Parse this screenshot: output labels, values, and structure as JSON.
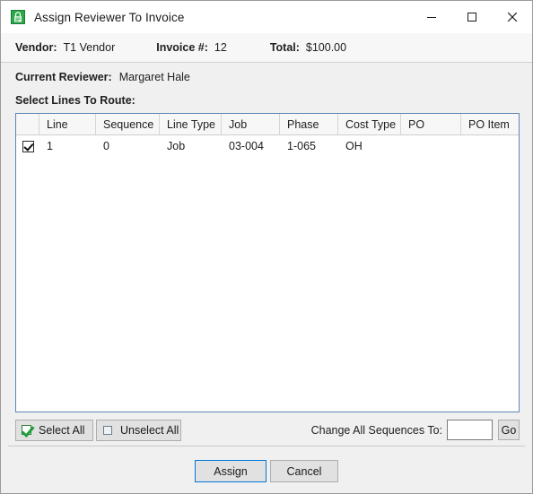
{
  "window": {
    "title": "Assign Reviewer To Invoice",
    "icon": "app-lock-icon",
    "controls": {
      "minimize": "—",
      "maximize": "☐",
      "close": "✕"
    }
  },
  "header": {
    "vendor_label": "Vendor:",
    "vendor_value": "T1 Vendor",
    "invoice_label": "Invoice #:",
    "invoice_value": "12",
    "total_label": "Total:",
    "total_value": "$100.00"
  },
  "reviewer": {
    "label": "Current Reviewer:",
    "value": "Margaret Hale"
  },
  "section": {
    "select_lines_label": "Select Lines To Route:"
  },
  "grid": {
    "columns": [
      "",
      "Line",
      "Sequence",
      "Line Type",
      "Job",
      "Phase",
      "Cost Type",
      "PO",
      "PO Item"
    ],
    "rows": [
      {
        "checked": true,
        "line": "1",
        "sequence": "0",
        "line_type": "Job",
        "job": "03-004",
        "phase": "1-065",
        "cost_type": "OH",
        "po": "",
        "po_item": ""
      }
    ]
  },
  "toolbar": {
    "select_all_label": "Select All",
    "unselect_all_label": "Unselect All",
    "change_sequences_label": "Change All Sequences To:",
    "sequence_input_value": "",
    "sequence_input_placeholder": "",
    "go_label": "Go"
  },
  "actions": {
    "assign_label": "Assign",
    "cancel_label": "Cancel"
  },
  "colors": {
    "accent": "#0078d7",
    "grid_border": "#5b87b5",
    "icon_green": "#1e9e3a",
    "window_bg": "#f0f0f0"
  }
}
